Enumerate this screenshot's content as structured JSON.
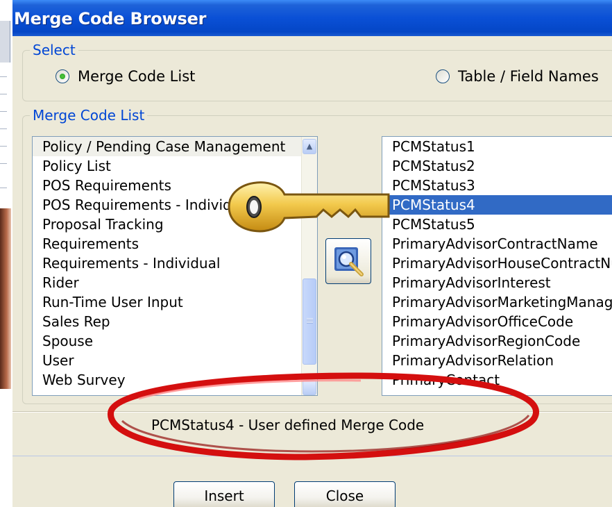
{
  "window": {
    "title": "Merge Code Browser"
  },
  "select_group": {
    "legend": "Select",
    "options": [
      {
        "label": "Merge Code List",
        "checked": true
      },
      {
        "label": "Table / Field Names",
        "checked": false
      }
    ]
  },
  "merge_group": {
    "legend": "Merge Code List",
    "categories": [
      "Policy / Pending Case Management",
      "Policy List",
      "POS Requirements",
      "POS Requirements - Individual",
      "Proposal Tracking",
      "Requirements",
      "Requirements - Individual",
      "Rider",
      "Run-Time User Input",
      "Sales Rep",
      "Spouse",
      "User",
      "Web Survey"
    ],
    "codes": [
      "PCMStatus1",
      "PCMStatus2",
      "PCMStatus3",
      "PCMStatus4",
      "PCMStatus5",
      "PrimaryAdvisorContractName",
      "PrimaryAdvisorHouseContractNum",
      "PrimaryAdvisorInterest",
      "PrimaryAdvisorMarketingManager",
      "PrimaryAdvisorOfficeCode",
      "PrimaryAdvisorRegionCode",
      "PrimaryAdvisorRelation",
      "PrimaryContact"
    ],
    "selected_code": "PCMStatus4"
  },
  "status": {
    "text": "PCMStatus4 - User defined Merge Code"
  },
  "buttons": {
    "insert": "Insert",
    "close": "Close"
  },
  "icons": {
    "find": "magnifier-icon",
    "key": "key-icon",
    "highlight": "red-ellipse-highlight"
  },
  "colors": {
    "title_bar": "#0a50d6",
    "legend_text": "#0046d5",
    "selection": "#316ac5",
    "highlight_red": "#d40f0f",
    "key_gold": "#f2c94c"
  }
}
